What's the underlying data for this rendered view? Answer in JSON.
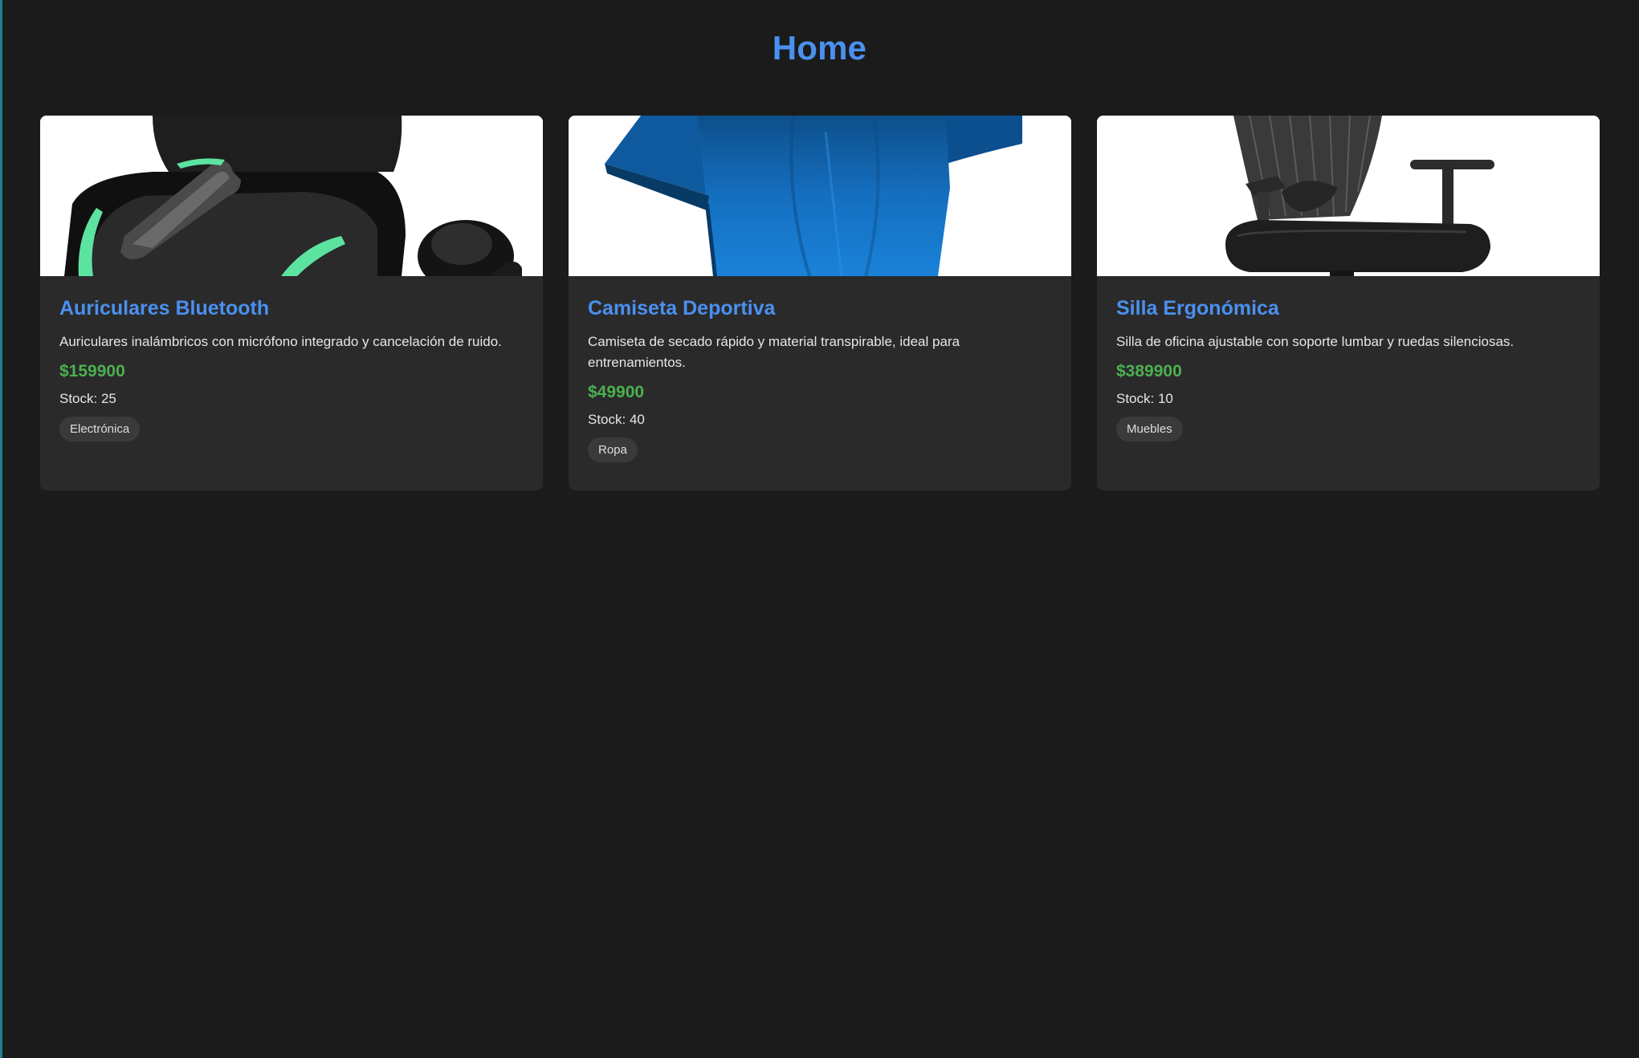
{
  "page": {
    "title": "Home"
  },
  "colors": {
    "background": "#1b1b1b",
    "card_background": "#2a2a2a",
    "title": "#4a90f0",
    "price": "#4cb050",
    "tag_background": "#3a3a3a"
  },
  "products": [
    {
      "name": "Auriculares Bluetooth",
      "description": "Auriculares inalámbricos con micrófono integrado y cancelación de ruido.",
      "price": "$159900",
      "stock": "Stock: 25",
      "category": "Electrónica",
      "image_icon": "earbuds-image"
    },
    {
      "name": "Camiseta Deportiva",
      "description": "Camiseta de secado rápido y material transpirable, ideal para entrenamientos.",
      "price": "$49900",
      "stock": "Stock: 40",
      "category": "Ropa",
      "image_icon": "tshirt-image"
    },
    {
      "name": "Silla Ergonómica",
      "description": "Silla de oficina ajustable con soporte lumbar y ruedas silenciosas.",
      "price": "$389900",
      "stock": "Stock: 10",
      "category": "Muebles",
      "image_icon": "office-chair-image"
    }
  ]
}
